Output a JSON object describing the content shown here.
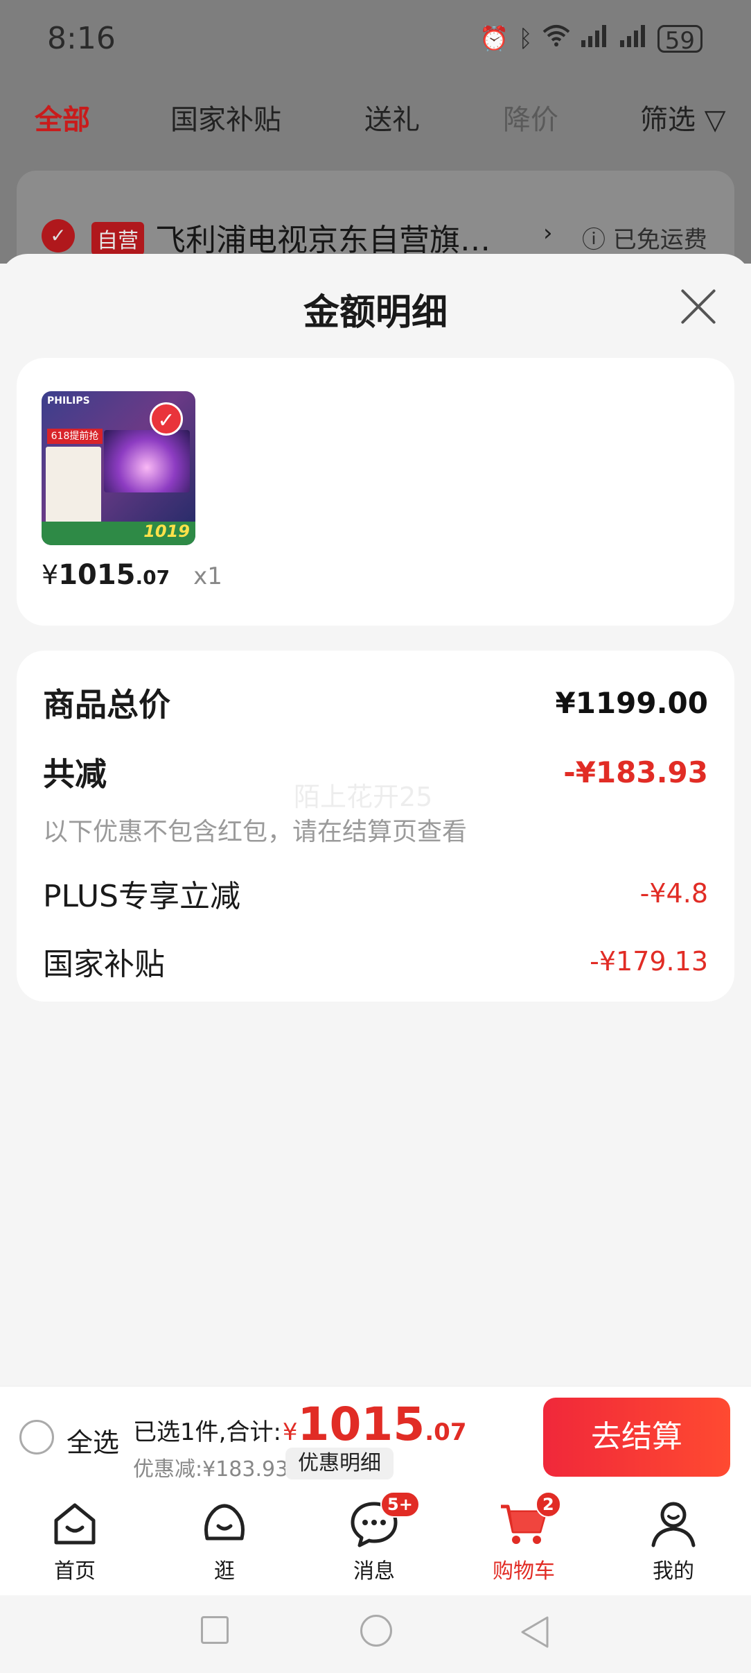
{
  "status_bar": {
    "time": "8:16",
    "battery": "59"
  },
  "tabs": [
    {
      "label": "全部",
      "active": true
    },
    {
      "label": "国家补贴"
    },
    {
      "label": "送礼"
    },
    {
      "label": "降价"
    },
    {
      "label": "筛选"
    }
  ],
  "store": {
    "badge": "自营",
    "name": "飞利浦电视京东自营旗…",
    "shipping": "ⓘ 已免运费"
  },
  "sheet": {
    "title": "金额明细",
    "product": {
      "brand": "PHILIPS",
      "promo_tag": "618提前抢",
      "image_price": "1019",
      "price_yen": "¥",
      "price_int": "1015",
      "price_dec": ".07",
      "quantity": "x1"
    },
    "total_label": "商品总价",
    "total_value": "¥1199.00",
    "reduce_label": "共减",
    "reduce_value": "-¥183.93",
    "reduce_note": "以下优惠不包含红包，请在结算页查看",
    "watermark": "陌上花开25",
    "items": [
      {
        "label": "PLUS专享立减",
        "value": "-¥4.8"
      },
      {
        "label": "国家补贴",
        "value": "-¥179.13"
      }
    ]
  },
  "checkout": {
    "select_all": "全选",
    "summary_label": "已选1件,合计:",
    "yen": "¥",
    "total_int": "1015",
    "total_dec": ".07",
    "discount": "优惠减:¥183.93",
    "detail_button": "优惠明细",
    "pay_button": "去结算"
  },
  "nav": [
    {
      "label": "首页",
      "icon": "home-icon"
    },
    {
      "label": "逛",
      "icon": "browse-icon"
    },
    {
      "label": "消息",
      "icon": "message-icon",
      "badge": "5+"
    },
    {
      "label": "购物车",
      "icon": "cart-icon",
      "badge": "2",
      "active": true
    },
    {
      "label": "我的",
      "icon": "profile-icon"
    }
  ],
  "colors": {
    "accent": "#e12c25",
    "overlay": "#7e7e7e"
  }
}
